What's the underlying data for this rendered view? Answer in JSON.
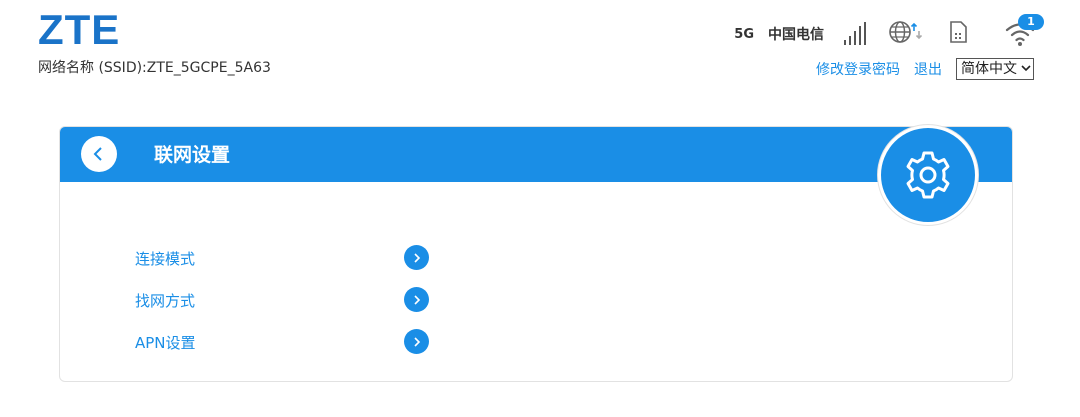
{
  "header": {
    "logo_text": "ZTE",
    "ssid_label": "网络名称 (SSID):",
    "ssid_value": "ZTE_5GCPE_5A63"
  },
  "status": {
    "network_type": "5G",
    "carrier": "中国电信",
    "wifi_clients": "1",
    "icons": [
      "signal-icon",
      "globe-icon",
      "sim-icon",
      "wifi-icon"
    ]
  },
  "top_links": {
    "change_password": "修改登录密码",
    "logout": "退出",
    "language": "简体中文"
  },
  "card": {
    "title": "联网设置",
    "items": [
      {
        "label": "连接模式"
      },
      {
        "label": "找网方式"
      },
      {
        "label": "APN设置"
      }
    ]
  },
  "colors": {
    "accent": "#1a8ee6",
    "logo": "#1a73c8"
  }
}
